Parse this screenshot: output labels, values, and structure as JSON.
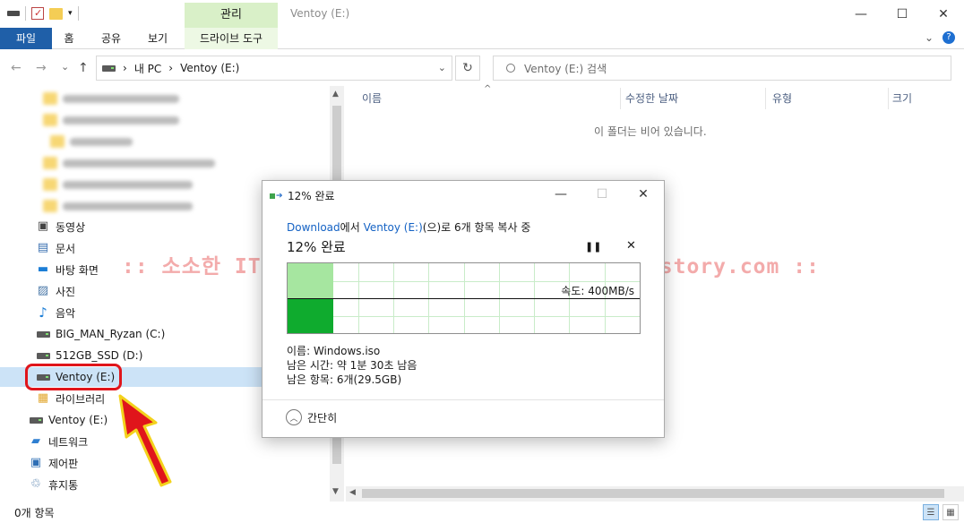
{
  "window": {
    "title": "Ventoy (E:)",
    "context_tab": "관리",
    "minimize": "—",
    "maximize": "☐",
    "close": "✕"
  },
  "ribbon": {
    "tabs": [
      "파일",
      "홈",
      "공유",
      "보기",
      "드라이브 도구"
    ],
    "expand": "⌄",
    "help": "?"
  },
  "address": {
    "back": "←",
    "forward": "→",
    "recent": "⌄",
    "up": "↑",
    "crumbs": [
      "내 PC",
      "Ventoy (E:)"
    ],
    "sep": "›",
    "dropdown": "⌄",
    "refresh": "↻",
    "search_placeholder": "Ventoy (E:) 검색"
  },
  "nav_pane": {
    "items": [
      {
        "label": "동영상",
        "icon": "video-icon"
      },
      {
        "label": "문서",
        "icon": "document-icon"
      },
      {
        "label": "바탕 화면",
        "icon": "desktop-icon"
      },
      {
        "label": "사진",
        "icon": "picture-icon"
      },
      {
        "label": "음악",
        "icon": "music-icon"
      },
      {
        "label": "BIG_MAN_Ryzan (C:)",
        "icon": "drive-icon"
      },
      {
        "label": "512GB_SSD (D:)",
        "icon": "drive-icon"
      },
      {
        "label": "Ventoy (E:)",
        "icon": "drive-icon",
        "selected": true
      },
      {
        "label": "라이브러리",
        "icon": "library-icon"
      },
      {
        "label": "Ventoy (E:)",
        "icon": "drive-icon"
      },
      {
        "label": "네트워크",
        "icon": "network-icon"
      },
      {
        "label": "제어판",
        "icon": "control-panel-icon"
      },
      {
        "label": "휴지통",
        "icon": "recycle-bin-icon"
      }
    ]
  },
  "content": {
    "columns": [
      "이름",
      "수정한 날짜",
      "유형",
      "크기"
    ],
    "sort_indicator": "^",
    "empty_message": "이 폴더는 비어 있습니다."
  },
  "watermark": ":: 소소한 IT 정보 :: https://kimseungjin.tistory.com ::",
  "status": {
    "item_count": "0개 항목"
  },
  "dialog": {
    "title": "12% 완료",
    "source": "Download",
    "text_from": "에서 ",
    "dest": "Ventoy (E:)",
    "text_rest": "(으)로 6개 항목 복사 중",
    "percent_text": "12% 완료",
    "pause": "❚❚",
    "cancel": "✕",
    "speed": "속도: 400MB/s",
    "name": "이름: Windows.iso",
    "time_left": "남은 시간: 약 1분 30초 남음",
    "items_left": "남은 항목: 6개(29.5GB)",
    "less_details": "간단히",
    "chevron": "︿",
    "progress_fraction": 0.12,
    "speed_fraction": 0.5
  },
  "colors": {
    "file_tab": "#1f5fa8",
    "context_tab": "#d9f0c8",
    "selection": "#cce3f7",
    "progress_light": "#a6e6a0",
    "progress_dark": "#0fab2e",
    "link": "#1462c4",
    "highlight": "#e0151b"
  }
}
